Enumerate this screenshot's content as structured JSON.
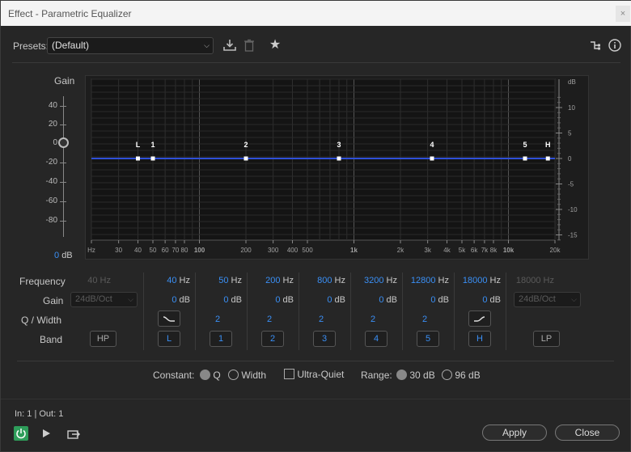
{
  "window": {
    "title": "Effect - Parametric Equalizer",
    "close": "×"
  },
  "toolbar": {
    "presets_label": "Presets:",
    "preset_value": "(Default)",
    "save_icon": "download-icon",
    "delete_icon": "trash-icon",
    "favorite_icon": "star-icon",
    "routing_icon": "routing-icon",
    "info_icon": "info-icon"
  },
  "graph": {
    "gain_label": "Gain",
    "gain_ticks": [
      "40",
      "20",
      "0",
      "-20",
      "-40",
      "-60",
      "-80"
    ],
    "gain_value": "0",
    "gain_unit": "dB",
    "db_label": "dB",
    "db_ticks": [
      "10",
      "5",
      "0",
      "-5",
      "-10",
      "-15"
    ],
    "freq_ticks": [
      "Hz",
      "30",
      "40",
      "50",
      "60",
      "70",
      "80",
      "100",
      "200",
      "300",
      "400",
      "500",
      "1k",
      "2k",
      "3k",
      "4k",
      "5k",
      "6k",
      "7k",
      "8k",
      "10k",
      "20k"
    ],
    "nodes": [
      "L",
      "1",
      "2",
      "3",
      "4",
      "5",
      "H"
    ]
  },
  "bands": {
    "row_labels": {
      "frequency": "Frequency",
      "gain": "Gain",
      "q": "Q / Width",
      "band": "Band"
    },
    "hp": {
      "freq": "40",
      "unit": "Hz",
      "gain": "24dB/Oct",
      "button": "HP"
    },
    "lp": {
      "freq": "18000",
      "unit": "Hz",
      "gain": "24dB/Oct",
      "button": "LP"
    },
    "items": [
      {
        "button": "L",
        "freq": "40",
        "unit": "Hz",
        "gain": "0",
        "gain_unit": "dB",
        "q": "",
        "shape": "low-shelf-icon"
      },
      {
        "button": "1",
        "freq": "50",
        "unit": "Hz",
        "gain": "0",
        "gain_unit": "dB",
        "q": "2"
      },
      {
        "button": "2",
        "freq": "200",
        "unit": "Hz",
        "gain": "0",
        "gain_unit": "dB",
        "q": "2"
      },
      {
        "button": "3",
        "freq": "800",
        "unit": "Hz",
        "gain": "0",
        "gain_unit": "dB",
        "q": "2"
      },
      {
        "button": "4",
        "freq": "3200",
        "unit": "Hz",
        "gain": "0",
        "gain_unit": "dB",
        "q": "2"
      },
      {
        "button": "5",
        "freq": "12800",
        "unit": "Hz",
        "gain": "0",
        "gain_unit": "dB",
        "q": "2"
      },
      {
        "button": "H",
        "freq": "18000",
        "unit": "Hz",
        "gain": "0",
        "gain_unit": "dB",
        "q": "",
        "shape": "high-shelf-icon"
      }
    ]
  },
  "options": {
    "constant_label": "Constant:",
    "q_label": "Q",
    "width_label": "Width",
    "ultra_quiet_label": "Ultra-Quiet",
    "range_label": "Range:",
    "range30_label": "30 dB",
    "range96_label": "96 dB"
  },
  "footer": {
    "io": "In: 1 | Out: 1",
    "apply": "Apply",
    "close": "Close",
    "power_icon": "power-icon",
    "play_icon": "play-icon",
    "export_icon": "export-icon"
  },
  "colors": {
    "accent": "#3a8ff5",
    "curve": "#2f4fd8",
    "power": "#2e9d5a"
  }
}
